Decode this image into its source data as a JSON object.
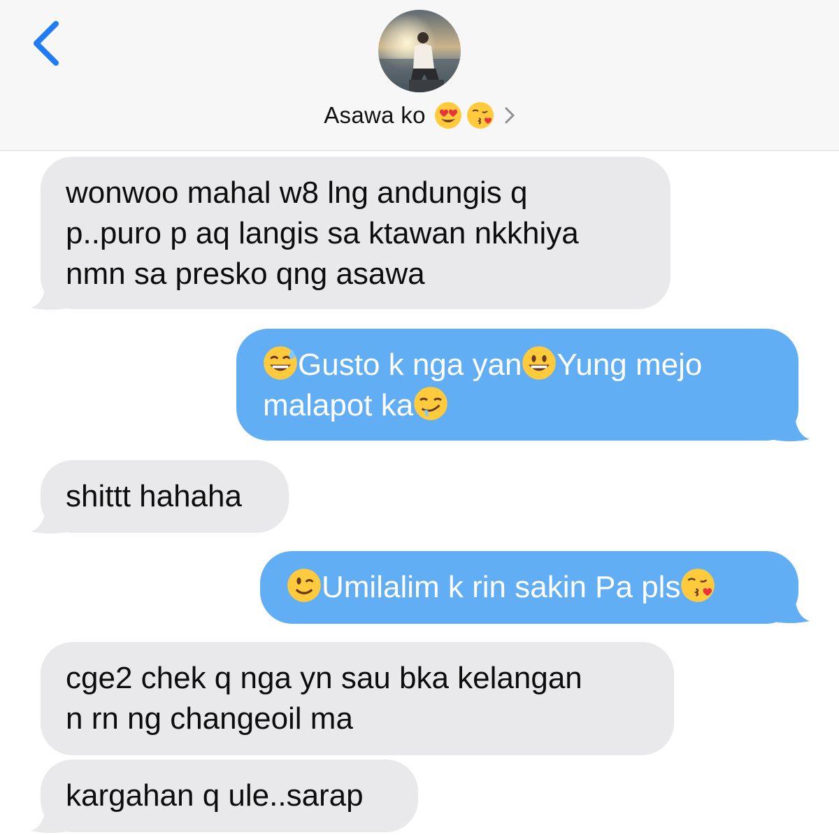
{
  "header": {
    "back_icon": "chevron-left-icon",
    "contact_name": "Asawa ko",
    "contact_emojis": [
      "heart-eyes-emoji",
      "kissing-heart-emoji"
    ],
    "details_icon": "chevron-right-icon"
  },
  "colors": {
    "accent": "#1f7cf4",
    "incoming_bubble": "#e9e9eb",
    "outgoing_bubble": "#62aef5",
    "header_bg": "#f7f7f8"
  },
  "messages": [
    {
      "direction": "incoming",
      "lines": [
        "wonwoo mahal w8 lng andungis q",
        "p..puro p aq langis sa ktawan nkkhiya",
        "nmn sa presko qng asawa"
      ]
    },
    {
      "direction": "outgoing",
      "line1_a": "Gusto k nga yan",
      "line1_b": "Yung mejo",
      "line2": "malapot ka",
      "emojis": [
        "sweat-smile-emoji",
        "grinning-emoji",
        "drooling-emoji"
      ]
    },
    {
      "direction": "incoming",
      "lines": [
        "shittt hahaha"
      ]
    },
    {
      "direction": "outgoing",
      "line1": "Umilalim k rin sakin Pa pls",
      "emojis": [
        "wink-emoji",
        "kissing-heart-emoji"
      ]
    },
    {
      "direction": "incoming",
      "lines": [
        "cge2 chek q nga yn sau bka kelangan",
        "n rn ng changeoil ma"
      ]
    },
    {
      "direction": "incoming",
      "lines": [
        "kargahan q ule..sarap"
      ]
    }
  ]
}
